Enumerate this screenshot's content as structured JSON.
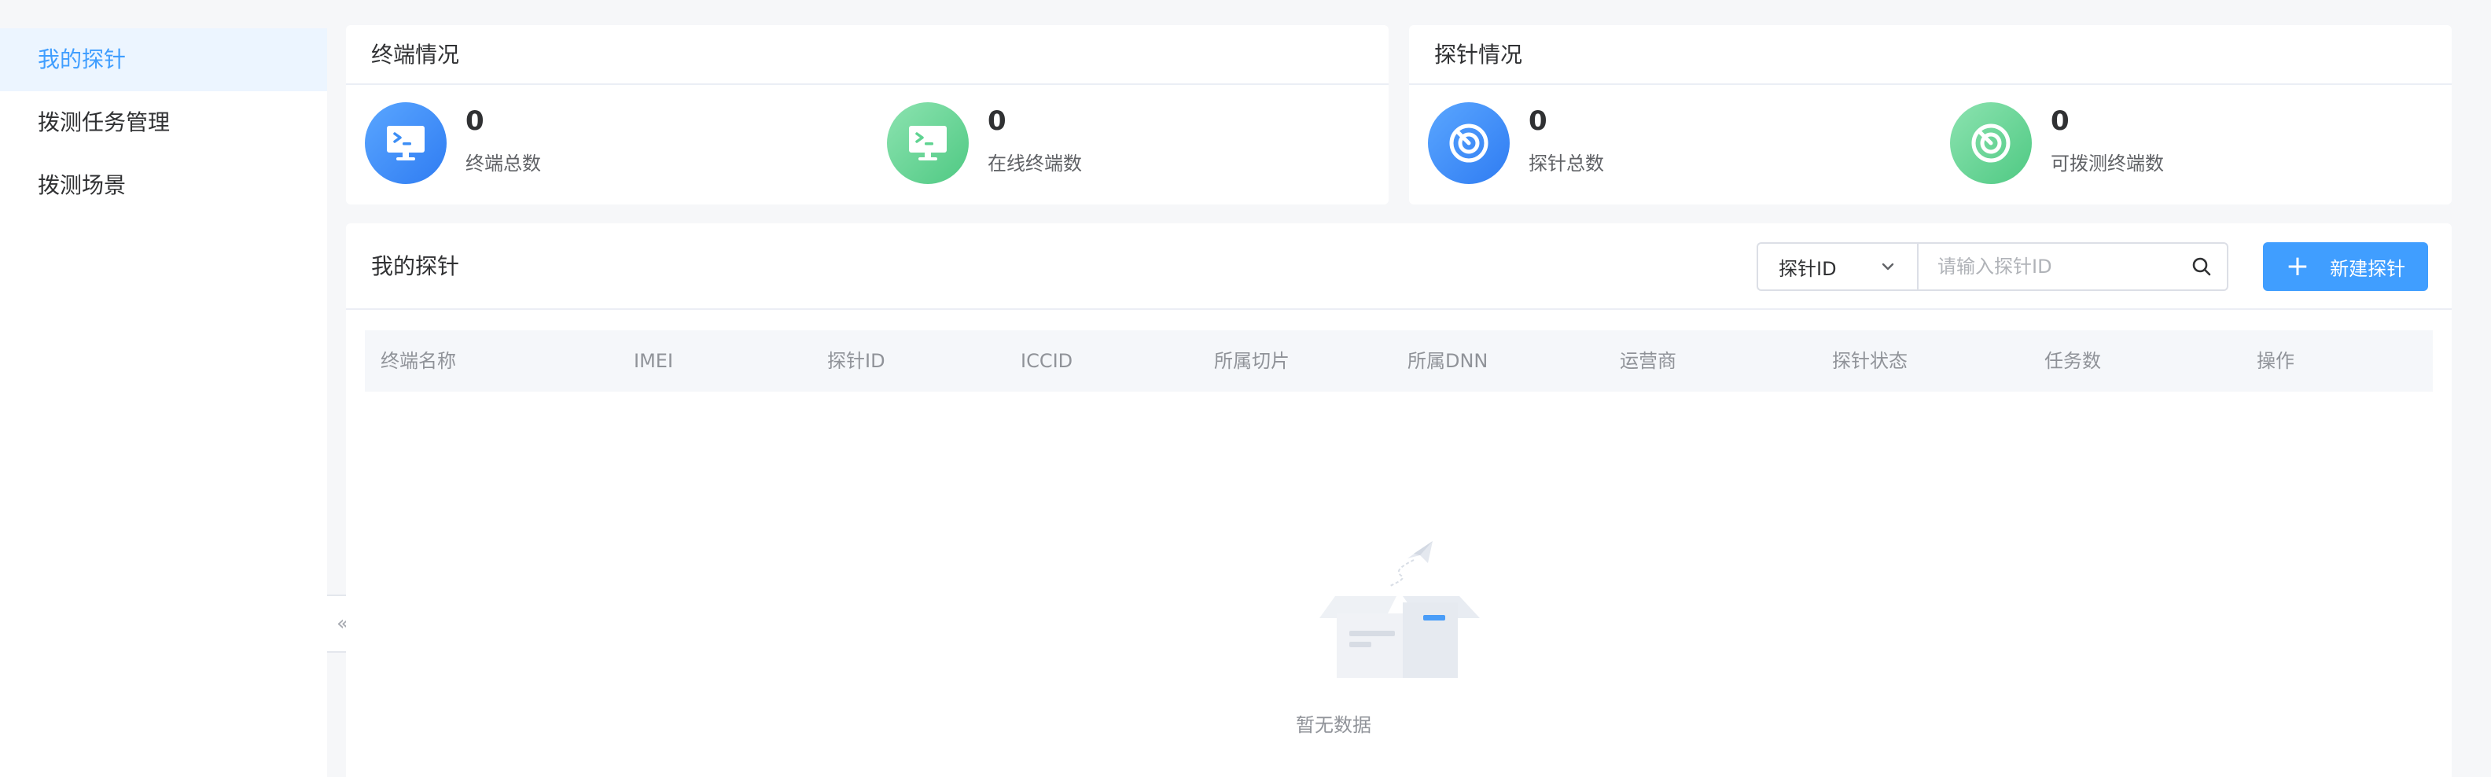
{
  "sidebar": {
    "items": [
      {
        "label": "我的探针",
        "active": true
      },
      {
        "label": "拨测任务管理",
        "active": false
      },
      {
        "label": "拨测场景",
        "active": false
      }
    ],
    "collapse_icon": "«"
  },
  "terminal_card": {
    "title": "终端情况",
    "stats": [
      {
        "value": "0",
        "label": "终端总数",
        "icon": "monitor-icon",
        "color": "#3d8ef5"
      },
      {
        "value": "0",
        "label": "在线终端数",
        "icon": "monitor-icon",
        "color": "#5fd391"
      }
    ]
  },
  "probe_card": {
    "title": "探针情况",
    "stats": [
      {
        "value": "0",
        "label": "探针总数",
        "icon": "probe-icon",
        "color": "#3d8ef5"
      },
      {
        "value": "0",
        "label": "可拨测终端数",
        "icon": "probe-icon",
        "color": "#5fd391"
      }
    ]
  },
  "main": {
    "title": "我的探针",
    "filter": {
      "selected": "探针ID"
    },
    "search": {
      "placeholder": "请输入探针ID",
      "value": ""
    },
    "add_button": {
      "plus": "+",
      "label": "新建探针"
    },
    "columns": [
      "终端名称",
      "IMEI",
      "探针ID",
      "ICCID",
      "所属切片",
      "所属DNN",
      "运营商",
      "探针状态",
      "任务数",
      "操作"
    ],
    "rows": [],
    "empty_text": "暂无数据"
  },
  "colors": {
    "accent": "#409eff",
    "green": "#5fd391",
    "blue": "#3d8ef5"
  }
}
